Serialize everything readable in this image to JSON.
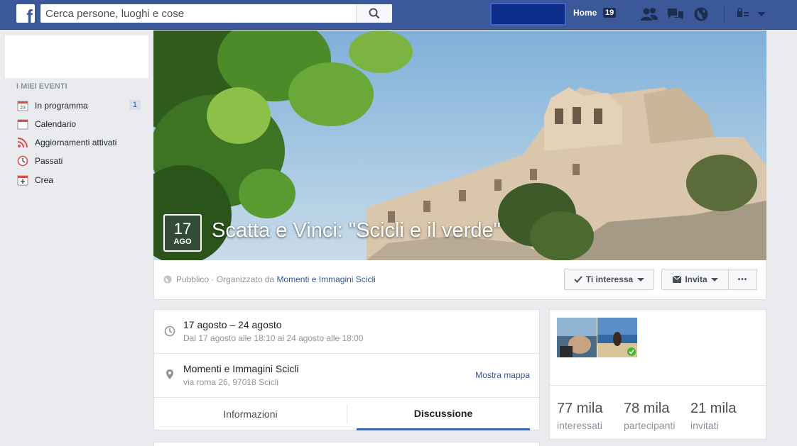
{
  "topbar": {
    "search_placeholder": "Cerca persone, luoghi e cose",
    "home_label": "Home",
    "home_count": "19",
    "icons": [
      "facebook-logo-icon",
      "search-icon",
      "friend-requests-icon",
      "messages-icon",
      "notifications-globe-icon",
      "privacy-shortcuts-icon",
      "account-menu-chevron-icon"
    ],
    "brand_color": "#3b5998"
  },
  "sidebar": {
    "section_title": "I MIEI EVENTI",
    "items": [
      {
        "label": "In programma",
        "icon": "calendar-day-icon",
        "count": "1"
      },
      {
        "label": "Calendario",
        "icon": "calendar-icon"
      },
      {
        "label": "Aggiornamenti attivati",
        "icon": "rss-feed-icon"
      },
      {
        "label": "Passati",
        "icon": "clock-icon"
      },
      {
        "label": "Crea",
        "icon": "create-event-icon"
      }
    ]
  },
  "event": {
    "day": "17",
    "month": "AGO",
    "title": "Scatta e Vinci: \"Scicli e il verde\"",
    "privacy": "Pubblico",
    "organized_by": "· Organizzato da",
    "organizer": "Momenti e Immagini Scicli",
    "interest_button": "Ti interessa",
    "invite_button": "Invita",
    "more_button": "•••"
  },
  "details": {
    "date_main": "17 agosto – 24 agosto",
    "date_sub": "Dal 17 agosto alle 18:10 al 24 agosto alle 18:00",
    "place_main": "Momenti e Immagini Scicli",
    "place_sub": "via roma 26, 97018 Scicli",
    "map_link": "Mostra mappa",
    "tabs": [
      "Informazioni",
      "Discussione"
    ],
    "active_tab": "Discussione"
  },
  "stats": {
    "interested_count": "77 mila",
    "interested_label": "interessati",
    "going_count": "78 mila",
    "going_label": "partecipanti",
    "invited_count": "21 mila",
    "invited_label": "invitati"
  }
}
